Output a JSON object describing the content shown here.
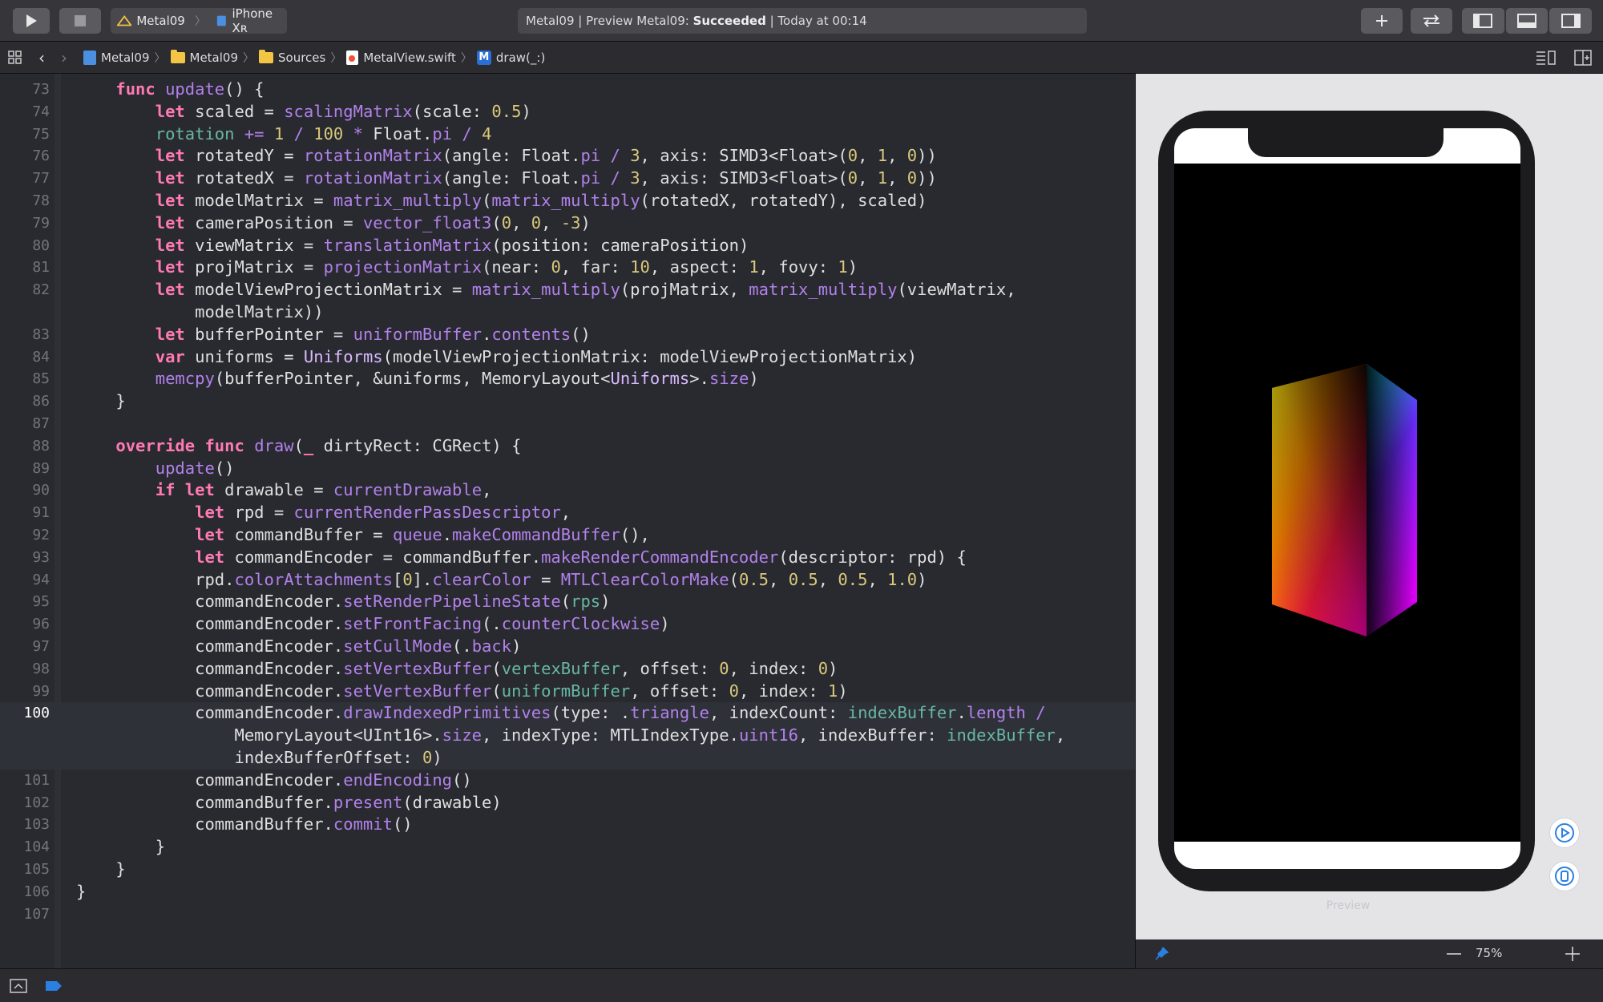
{
  "toolbar": {
    "scheme": {
      "project": "Metal09",
      "device": "iPhone Xʀ"
    },
    "activity": {
      "prefix": "Metal09 | Preview Metal09: ",
      "status": "Succeeded",
      "suffix": " | Today at 00:14"
    }
  },
  "breadcrumbs": [
    "Metal09",
    "Metal09",
    "Sources",
    "MetalView.swift",
    "draw(_:)"
  ],
  "editor": {
    "current_line": "100",
    "lines": [
      {
        "n": "73",
        "html": "    <span class=\"kw\">func</span> <span class=\"fn\">update</span>() {"
      },
      {
        "n": "74",
        "html": "        <span class=\"kw\">let</span> scaled = <span class=\"fn\">scalingMatrix</span>(scale: <span class=\"num\">0.5</span>)"
      },
      {
        "n": "75",
        "html": "        <span class=\"prop\">rotation</span> <span class=\"fn\">+=</span> <span class=\"num\">1</span> <span class=\"fn\">/</span> <span class=\"num\">100</span> <span class=\"fn\">*</span> Float.<span class=\"fn\">pi</span> <span class=\"fn\">/</span> <span class=\"num\">4</span>"
      },
      {
        "n": "76",
        "html": "        <span class=\"kw\">let</span> rotatedY = <span class=\"fn\">rotationMatrix</span>(angle: Float.<span class=\"fn\">pi</span> <span class=\"fn\">/</span> <span class=\"num\">3</span>, axis: SIMD3&lt;Float&gt;(<span class=\"num\">0</span>, <span class=\"num\">1</span>, <span class=\"num\">0</span>))"
      },
      {
        "n": "77",
        "html": "        <span class=\"kw\">let</span> rotatedX = <span class=\"fn\">rotationMatrix</span>(angle: Float.<span class=\"fn\">pi</span> <span class=\"fn\">/</span> <span class=\"num\">3</span>, axis: SIMD3&lt;Float&gt;(<span class=\"num\">0</span>, <span class=\"num\">1</span>, <span class=\"num\">0</span>))"
      },
      {
        "n": "78",
        "html": "        <span class=\"kw\">let</span> modelMatrix = <span class=\"fn\">matrix_multiply</span>(<span class=\"fn\">matrix_multiply</span>(rotatedX, rotatedY), scaled)"
      },
      {
        "n": "79",
        "html": "        <span class=\"kw\">let</span> cameraPosition = <span class=\"fn\">vector_float3</span>(<span class=\"num\">0</span>, <span class=\"num\">0</span>, <span class=\"num\">-3</span>)"
      },
      {
        "n": "80",
        "html": "        <span class=\"kw\">let</span> viewMatrix = <span class=\"fn\">translationMatrix</span>(position: cameraPosition)"
      },
      {
        "n": "81",
        "html": "        <span class=\"kw\">let</span> projMatrix = <span class=\"fn\">projectionMatrix</span>(near: <span class=\"num\">0</span>, far: <span class=\"num\">10</span>, aspect: <span class=\"num\">1</span>, fovy: <span class=\"num\">1</span>)"
      },
      {
        "n": "82",
        "html": "        <span class=\"kw\">let</span> modelViewProjectionMatrix = <span class=\"fn\">matrix_multiply</span>(projMatrix, <span class=\"fn\">matrix_multiply</span>(viewMatrix,"
      },
      {
        "n": "",
        "html": "            modelMatrix))"
      },
      {
        "n": "83",
        "html": "        <span class=\"kw\">let</span> bufferPointer = <span class=\"fn\">uniformBuffer</span>.<span class=\"fn\">contents</span>()"
      },
      {
        "n": "84",
        "html": "        <span class=\"kw\">var</span> uniforms = <span class=\"ty\">Uniforms</span>(modelViewProjectionMatrix: modelViewProjectionMatrix)"
      },
      {
        "n": "85",
        "html": "        <span class=\"fn\">memcpy</span>(bufferPointer, &amp;uniforms, MemoryLayout&lt;<span class=\"ty\">Uniforms</span>&gt;.<span class=\"fn\">size</span>)"
      },
      {
        "n": "86",
        "html": "    }"
      },
      {
        "n": "87",
        "html": ""
      },
      {
        "n": "88",
        "html": "    <span class=\"kw\">override</span> <span class=\"kw\">func</span> <span class=\"fn\">draw</span>(<span class=\"kw\">_</span> dirtyRect: CGRect) {"
      },
      {
        "n": "89",
        "html": "        <span class=\"fn\">update</span>()"
      },
      {
        "n": "90",
        "html": "        <span class=\"kw\">if</span> <span class=\"kw\">let</span> drawable = <span class=\"fn\">currentDrawable</span>,"
      },
      {
        "n": "91",
        "html": "            <span class=\"kw\">let</span> rpd = <span class=\"fn\">currentRenderPassDescriptor</span>,"
      },
      {
        "n": "92",
        "html": "            <span class=\"kw\">let</span> commandBuffer = <span class=\"fn\">queue</span>.<span class=\"fn\">makeCommandBuffer</span>(),"
      },
      {
        "n": "93",
        "html": "            <span class=\"kw\">let</span> commandEncoder = commandBuffer.<span class=\"fn\">makeRenderCommandEncoder</span>(descriptor: rpd) {"
      },
      {
        "n": "94",
        "html": "            rpd.<span class=\"fn\">colorAttachments</span>[<span class=\"num\">0</span>].<span class=\"fn\">clearColor</span> = <span class=\"fn\">MTLClearColorMake</span>(<span class=\"num\">0.5</span>, <span class=\"num\">0.5</span>, <span class=\"num\">0.5</span>, <span class=\"num\">1.0</span>)"
      },
      {
        "n": "95",
        "html": "            commandEncoder.<span class=\"fn\">setRenderPipelineState</span>(<span class=\"prop\">rps</span>)"
      },
      {
        "n": "96",
        "html": "            commandEncoder.<span class=\"fn\">setFrontFacing</span>(.<span class=\"fn\">counterClockwise</span>)"
      },
      {
        "n": "97",
        "html": "            commandEncoder.<span class=\"fn\">setCullMode</span>(.<span class=\"fn\">back</span>)"
      },
      {
        "n": "98",
        "html": "            commandEncoder.<span class=\"fn\">setVertexBuffer</span>(<span class=\"prop\">vertexBuffer</span>, offset: <span class=\"num\">0</span>, index: <span class=\"num\">0</span>)"
      },
      {
        "n": "99",
        "html": "            commandEncoder.<span class=\"fn\">setVertexBuffer</span>(<span class=\"prop\">uniformBuffer</span>, offset: <span class=\"num\">0</span>, index: <span class=\"num\">1</span>)"
      },
      {
        "n": "100",
        "html": "            commandEncoder.<span class=\"fn\">drawIndexedPrimitives</span>(type: .<span class=\"fn\">triangle</span>, indexCount: <span class=\"prop\">indexBuffer</span>.<span class=\"fn\">length</span> <span class=\"fn\">/</span>"
      },
      {
        "n": "",
        "html": "                MemoryLayout&lt;UInt16&gt;.<span class=\"fn\">size</span>, indexType: MTLIndexType.<span class=\"fn\">uint16</span>, indexBuffer: <span class=\"prop\">indexBuffer</span>,"
      },
      {
        "n": "",
        "html": "                indexBufferOffset: <span class=\"num\">0</span>)"
      },
      {
        "n": "101",
        "html": "            commandEncoder.<span class=\"fn\">endEncoding</span>()"
      },
      {
        "n": "102",
        "html": "            commandBuffer.<span class=\"fn\">present</span>(drawable)"
      },
      {
        "n": "103",
        "html": "            commandBuffer.<span class=\"fn\">commit</span>()"
      },
      {
        "n": "104",
        "html": "        }"
      },
      {
        "n": "105",
        "html": "    }"
      },
      {
        "n": "106",
        "html": "}"
      },
      {
        "n": "107",
        "html": ""
      }
    ]
  },
  "preview": {
    "label": "Preview",
    "zoom": "75%"
  },
  "colors": {
    "accent": "#2a7fe0",
    "keyword": "#ff7ab2",
    "function": "#b281eb",
    "number": "#d9c97c",
    "property": "#67b7a4"
  }
}
